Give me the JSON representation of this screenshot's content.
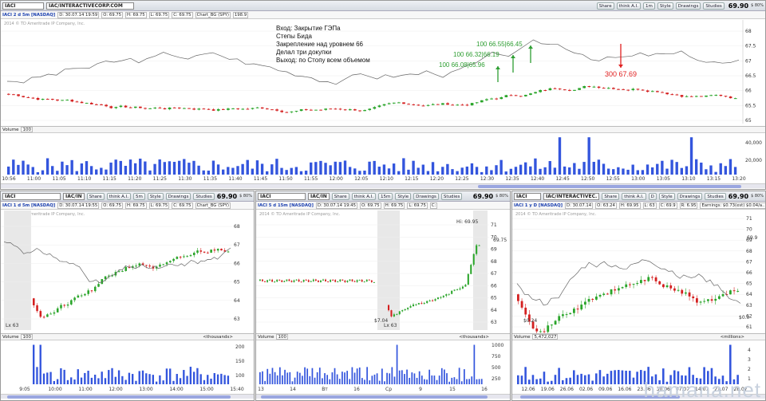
{
  "top": {
    "symbol": "IACI",
    "company": "IAC/INTERACTIVECORP.COM",
    "share": "Share",
    "think": "think A.I.",
    "timeframe": "1m",
    "style": "Style",
    "drawings": "Drawings",
    "studies": "Studies",
    "price": "69.90",
    "pct": "$ 80%",
    "info_label": "IACI 2 d 5m [NASDAQ]",
    "info_date": "D: 30.07.14 19:59",
    "info_o": "O: 69.75",
    "info_h": "H: 69.75",
    "info_l": "L: 69.75",
    "info_c": "C: 69.75",
    "info_chart": "Chart_BG (SPY)",
    "info_chart_val": "198.9",
    "copyright": "2014 © TD Ameritrade IP Company, Inc.",
    "notes": [
      "Вход:  Закрытие ГЭПа",
      "Степы Бида",
      "Закрепление над уровнем 66",
      "Делал три докупки",
      "Выход: по Стопу всем объемом"
    ],
    "buys": [
      "100   66.08|65.96",
      "100   66.32|66.19",
      "100   66.55|66.45"
    ],
    "sell": "300   67.69",
    "yaxis": [
      "68",
      "67.5",
      "67",
      "66.5",
      "66",
      "65.5",
      "65"
    ],
    "volume_label": "Volume",
    "volume_val": "100",
    "vol_axis": [
      "40,000",
      "20,000"
    ],
    "xaxis": [
      "10:56",
      "11:00",
      "11:05",
      "11:10",
      "11:15",
      "11:20",
      "11:25",
      "11:30",
      "11:35",
      "11:40",
      "11:45",
      "11:50",
      "11:55",
      "12:00",
      "12:05",
      "12:10",
      "12:15",
      "12:20",
      "12:25",
      "12:30",
      "12:35",
      "12:40",
      "12:45",
      "12:50",
      "12:55",
      "13:00",
      "13:05",
      "13:10",
      "13:15",
      "13:20"
    ]
  },
  "p1": {
    "symbol": "IACI",
    "company": "IAC/IN",
    "share": "Share",
    "think": "think A.I.",
    "timeframe": "5m",
    "style": "Style",
    "drawings": "Drawings",
    "studies": "Studies",
    "price": "69.90",
    "pct": "$ 80%",
    "info_label": "IACI 1 d 5m [NASDAQ]",
    "info_date": "D: 30.07.14 19:55",
    "info_o": "O: 69.75",
    "info_h": "H: 69.75",
    "info_l": "L: 69.75",
    "info_c": "C: 69.75",
    "info_chart": "Chart_BG (SPY)",
    "copyright": "2014 © TD Ameritrade IP Company, Inc.",
    "yaxis": [
      "68",
      "67",
      "66",
      "65",
      "64",
      "63"
    ],
    "lx": "Lx 63",
    "volume_label": "Volume",
    "volume_val": "100",
    "units": "<thousands>",
    "vol_axis": [
      "200",
      "150",
      "100"
    ],
    "xaxis": [
      "9:05",
      "10:00",
      "11:00",
      "12:00",
      "13:00",
      "14:00",
      "15:00",
      "15:40"
    ]
  },
  "p2": {
    "symbol": "IACI",
    "company": "IAC/IN",
    "share": "Share",
    "think": "think A.I.",
    "timeframe": "15m",
    "style": "Style",
    "drawings": "Drawings",
    "studies": "Studies",
    "price": "69.90",
    "pct": "$ 80%",
    "info_label": "IACI 5 d 15m [NASDAQ]",
    "info_date": "D: 30.07.14 19:45",
    "info_o": "O: 69.75",
    "info_h": "H: 69.75",
    "info_l": "L: 69.75",
    "info_c": "C:",
    "copyright": "2014 © TD Ameritrade IP Company, Inc.",
    "hi": "Hi: 69.95",
    "current": "69.75",
    "yaxis": [
      "71",
      "70",
      "69",
      "68",
      "67",
      "66",
      "65",
      "64",
      "63"
    ],
    "lx": "Lx 63",
    "lo": "$7.04",
    "volume_label": "Volume",
    "volume_val": "100",
    "units": "<thousands>",
    "vol_axis": [
      "1000",
      "750",
      "500",
      "250"
    ],
    "xaxis": [
      "13",
      "14",
      "Вт",
      "16",
      "Ср",
      "9",
      "15",
      "16"
    ]
  },
  "p3": {
    "symbol": "IACI",
    "company": "IAC/INTERACTIVEC.",
    "share": "Share",
    "think": "think A.I.",
    "timeframe": "D",
    "style": "Style",
    "drawings": "Drawings",
    "studies": "Studies",
    "price": "69.90",
    "pct": "$ 80%",
    "info_label": "IACI 1 y D [NASDAQ]",
    "info_date": "D: 30.07.14",
    "info_o": "O: 63.24",
    "info_h": "H: 69.95",
    "info_l": "L: 63",
    "info_c": "C: 69.9",
    "info_r": "R: 6.95",
    "info_earn": "Earnings: $0.73(est) $0.04/a...",
    "copyright": "2014 © TD Ameritrade IP Company, Inc.",
    "yaxis": [
      "71",
      "70",
      "69",
      "68",
      "67",
      "66",
      "65",
      "64",
      "63",
      "62",
      "61"
    ],
    "lbl_low": "$0.24",
    "lbl_right": "$0.0",
    "current": "69.9",
    "volume_label": "Volume",
    "volume_val": "5,472,027",
    "units": "<millions>",
    "vol_axis": [
      "4",
      "3",
      "2",
      "1"
    ],
    "xaxis": [
      "12.06",
      "19.06",
      "26.06",
      "02.06",
      "09.06",
      "16.06",
      "23.06",
      "30.06",
      "07.07",
      "14.07",
      "21.07",
      "28.07"
    ]
  },
  "watermark": "hamana.net"
}
